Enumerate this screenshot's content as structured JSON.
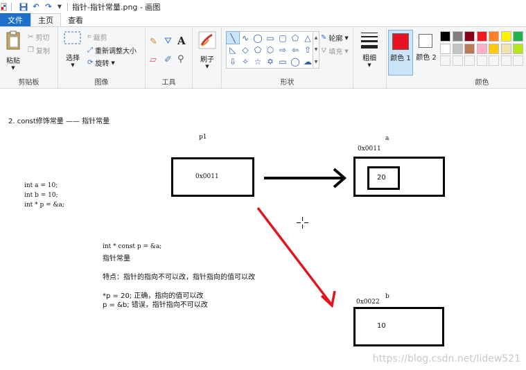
{
  "titlebar": {
    "title": "指针-指针常量.png - 画图",
    "icons": [
      "paint-app-icon",
      "save-icon",
      "undo-icon",
      "redo-icon",
      "customize-icon"
    ]
  },
  "tabs": [
    "文件",
    "主页",
    "查看"
  ],
  "ribbon": {
    "clipboard": {
      "label": "剪贴板",
      "paste": "粘贴",
      "cut": "剪切",
      "copy": "复制"
    },
    "image": {
      "label": "图像",
      "select": "选择",
      "crop": "裁剪",
      "resize": "重新调整大小",
      "rotate": "旋转"
    },
    "tools": {
      "label": "工具"
    },
    "brushes": {
      "label": "刷子"
    },
    "shapes": {
      "label": "形状",
      "outline": "轮廓",
      "fill": "填充"
    },
    "size": {
      "label": "粗细"
    },
    "color1": {
      "label": "颜色 1",
      "value": "#e81123"
    },
    "color2": {
      "label": "颜色 2",
      "value": "#ffffff"
    },
    "colors": {
      "label": "颜色"
    },
    "palette": [
      "#000000",
      "#7f7f7f",
      "#880015",
      "#ed1c24",
      "#ff7f27",
      "#fff200",
      "#22b14c",
      "#ffffff",
      "#c3c3c3",
      "#b97a57",
      "#ffaec9",
      "#ffc90e",
      "#efe4b0",
      "#b5e61d"
    ]
  },
  "canvas": {
    "heading": "2. const修饰常量   —— 指针常量",
    "code_decl": [
      "int a = 10;",
      "int b = 10;",
      "int * p = &a;"
    ],
    "p1_label": "p1",
    "p1_value": "0x0011",
    "a_label": "a",
    "a_addr": "0x0011",
    "a_value": "20",
    "b_label": "b",
    "b_addr": "0x0022",
    "b_value": "10",
    "note_code": "int * const p = &a;",
    "note_title": "指针常量",
    "note_feature": "特点：指针的指向不可以改，指针指向的值可以改",
    "note_ok": "*p = 20;   正确，指向的值可以改",
    "note_err": "p = &b;    错误，指针指向不可以改",
    "watermark": "https://blog.csdn.net/lidew521"
  }
}
